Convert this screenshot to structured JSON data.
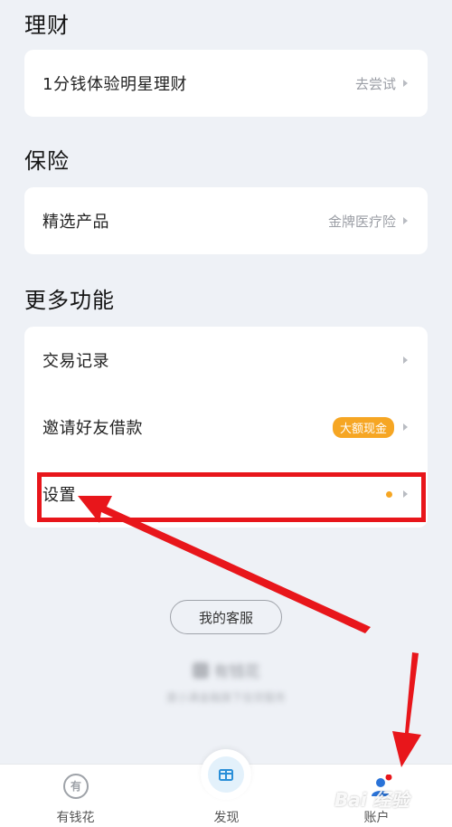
{
  "sections": {
    "wealth": {
      "title": "理财",
      "rows": [
        {
          "label": "1分钱体验明星理财",
          "hint": "去尝试"
        }
      ]
    },
    "insurance": {
      "title": "保险",
      "rows": [
        {
          "label": "精选产品",
          "hint": "金牌医疗险"
        }
      ]
    },
    "more": {
      "title": "更多功能",
      "rows": [
        {
          "label": "交易记录"
        },
        {
          "label": "邀请好友借款",
          "badge": "大额现金"
        },
        {
          "label": "设置"
        }
      ]
    }
  },
  "service_button": "我的客服",
  "brand": {
    "name": "有钱花",
    "tagline": "度小满金融旗下信贷服务"
  },
  "tabbar": {
    "tabs": [
      {
        "label": "有钱花",
        "icon": "youqianhua-icon",
        "glyph": "有"
      },
      {
        "label": "发现",
        "icon": "gift-icon"
      },
      {
        "label": "账户",
        "icon": "account-icon"
      }
    ]
  },
  "watermark": "Bai 经验",
  "colors": {
    "accent": "#f6a623",
    "highlight": "#e8161b",
    "background": "#eef1f6"
  }
}
